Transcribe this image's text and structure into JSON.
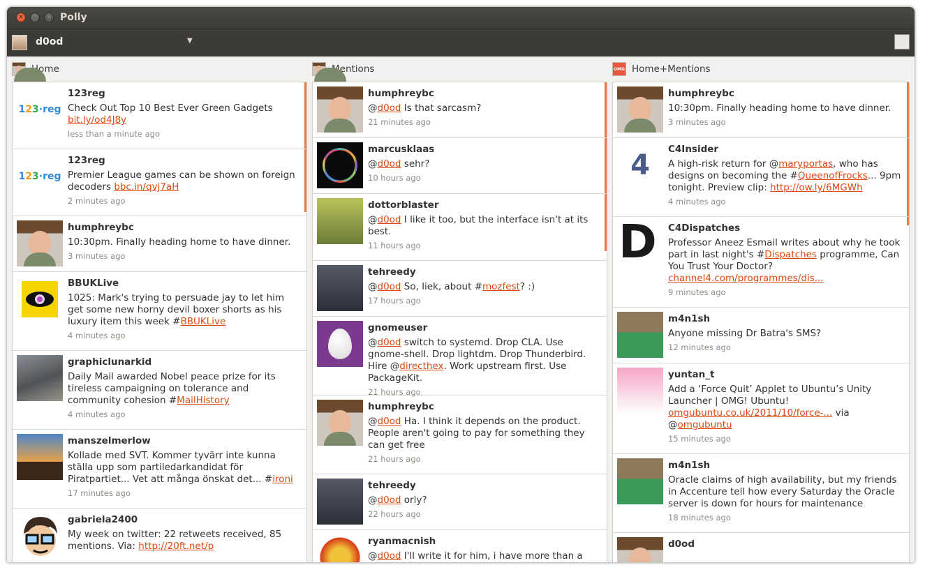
{
  "window": {
    "title": "Polly"
  },
  "toolbar": {
    "account_name": "d0od"
  },
  "columns": [
    {
      "title": "Home",
      "tweets": [
        {
          "user": "123reg",
          "avatar": "123reg-logo",
          "text": "Check Out Top 10 Best Ever Green Gadgets ",
          "link": "bit.ly/od4J8y",
          "time": "less than a minute ago"
        },
        {
          "user": "123reg",
          "avatar": "123reg-logo",
          "text": "Premier League games can be shown on foreign decoders ",
          "link": "bbc.in/qvj7aH",
          "time": "2 minutes ago"
        },
        {
          "user": "humphreybc",
          "avatar": "photo",
          "text": "10:30pm. Finally heading home to have dinner.",
          "link": "",
          "time": "3 minutes ago"
        },
        {
          "user": "BBUKLive",
          "avatar": "eye-logo",
          "text": "1025: Mark's trying to persuade jay to let him get some new horny devil boxer shorts as his luxury item this week #",
          "link": "BBUKLive",
          "time": "4 minutes ago"
        },
        {
          "user": "graphiclunarkid",
          "avatar": "photo",
          "text": "Daily Mail awarded Nobel peace prize for its tireless campaigning on tolerance and community cohesion #",
          "link": "MailHistory",
          "time": "4 minutes ago"
        },
        {
          "user": "manszelmerlow",
          "avatar": "photo",
          "text": "Kollade med SVT. Kommer tyvärr inte kunna ställa upp som partiledarkandidat för Piratpartiet... Vet att många önskat det... #",
          "link": "ironi",
          "time": "17 minutes ago"
        },
        {
          "user": "gabriela2400",
          "avatar": "cartoon",
          "text": "My week on twitter: 22 retweets received, 85 mentions. Via: ",
          "link": "http://20ft.net/p",
          "time": ""
        }
      ]
    },
    {
      "title": "Mentions",
      "tweets": [
        {
          "user": "humphreybc",
          "avatar": "photo",
          "pre": "@",
          "mention": "d0od",
          "text": " Is that sarcasm?",
          "time": "21 minutes ago"
        },
        {
          "user": "marcusklaas",
          "avatar": "prism",
          "pre": "@",
          "mention": "d0od",
          "text": " sehr?",
          "time": "10 hours ago"
        },
        {
          "user": "dottorblaster",
          "avatar": "photo",
          "pre": "@",
          "mention": "d0od",
          "text": " I like it too, but the interface isn't at its best.",
          "time": "11 hours ago"
        },
        {
          "user": "tehreedy",
          "avatar": "photo",
          "pre": "@",
          "mention": "d0od",
          "text": " So, liek, about #",
          "link2": "mozfest",
          "text2": "? :)",
          "time": "17 hours ago"
        },
        {
          "user": "gnomeuser",
          "avatar": "egg",
          "pre": "@",
          "mention": "d0od",
          "text": " switch to systemd. Drop CLA. Use gnome-shell. Drop lightdm. Drop Thunderbird. Hire @",
          "link2": "directhex",
          "text2": ". Work upstream first. Use PackageKit.",
          "time": "21 hours ago"
        },
        {
          "user": "humphreybc",
          "avatar": "photo",
          "pre": "@",
          "mention": "d0od",
          "text": " Ha. I think it depends on the product. People aren't going to pay for something they can get free",
          "time": "21 hours ago"
        },
        {
          "user": "tehreedy",
          "avatar": "photo",
          "pre": "@",
          "mention": "d0od",
          "text": " orly?",
          "time": "22 hours ago"
        },
        {
          "user": "ryanmacnish",
          "avatar": "lion",
          "pre": "@",
          "mention": "d0od",
          "text": " I'll write it for him, i have more than a few",
          "time": ""
        }
      ]
    },
    {
      "title": "Home+Mentions",
      "tweets": [
        {
          "user": "humphreybc",
          "avatar": "photo",
          "text": "10:30pm. Finally heading home to have dinner.",
          "time": "3 minutes ago"
        },
        {
          "user": "C4Insider",
          "avatar": "channel4-logo",
          "text": "A high-risk return for @",
          "link": "maryportas",
          "text2": ", who has designs on becoming the #",
          "link2": "QueenofFrocks",
          "text3": "... 9pm tonight. Preview clip: ",
          "link3": "http://ow.ly/6MGWh",
          "time": "4 minutes ago"
        },
        {
          "user": "C4Dispatches",
          "avatar": "dispatches-logo",
          "text": "Professor Aneez Esmail writes about why he took part in last night's #",
          "link": "Dispatches",
          "text2": " programme, Can You Trust Your Doctor? ",
          "link2": "channel4.com/programmes/dis...",
          "time": "9 minutes ago"
        },
        {
          "user": "m4n1sh",
          "avatar": "photo",
          "text": "Anyone missing Dr Batra's SMS?",
          "time": "12 minutes ago"
        },
        {
          "user": "yuntan_t",
          "avatar": "anime",
          "text": "Add a ‘Force Quit’ Applet to Ubuntu’s Unity Launcher | OMG! Ubuntu! ",
          "link": "omgubuntu.co.uk/2011/10/force-...",
          "text2": " via @",
          "link2": "omgubuntu",
          "time": "15 minutes ago"
        },
        {
          "user": "m4n1sh",
          "avatar": "photo",
          "text": "Oracle claims of high availability, but my friends in Accenture tell how every Saturday the Oracle server is down for hours for maintenance",
          "time": "18 minutes ago"
        },
        {
          "user": "d0od",
          "avatar": "photo",
          "text": "",
          "time": ""
        }
      ]
    }
  ],
  "colors": {
    "accent": "#dd4814",
    "scroll": "#f07746",
    "titlebar": "#3c3b37"
  }
}
